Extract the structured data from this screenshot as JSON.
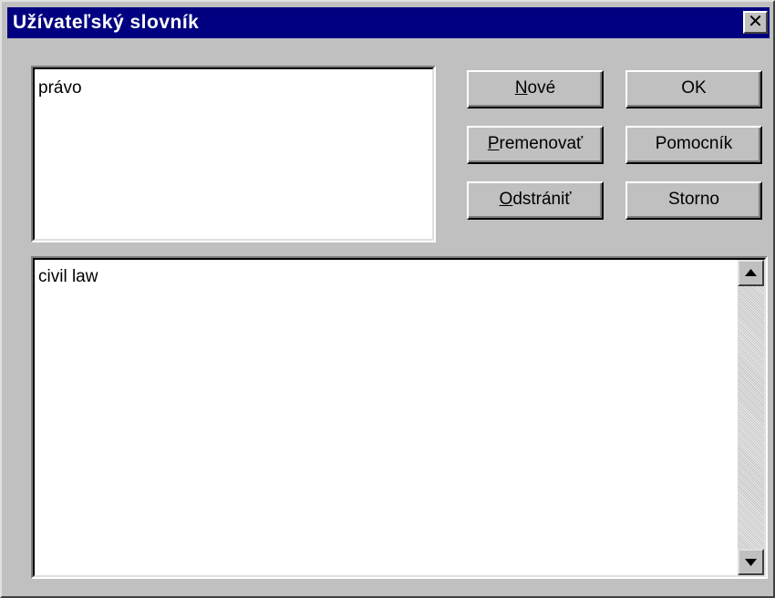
{
  "window": {
    "title": "Užívateľský slovník",
    "close_glyph": "✕"
  },
  "words_list": {
    "value": "právo"
  },
  "buttons": {
    "new": {
      "mnemonic": "N",
      "rest": "ové"
    },
    "rename": {
      "mnemonic": "P",
      "rest": "remenovať"
    },
    "delete": {
      "mnemonic": "O",
      "rest": "dstrániť"
    },
    "ok": "OK",
    "help": "Pomocník",
    "cancel": "Storno"
  },
  "definition_area": {
    "value": "civil law"
  },
  "colors": {
    "titlebar": "#000080",
    "dialog_bg": "#c0c0c0",
    "field_bg": "#ffffff"
  },
  "icons": {
    "close": "close-icon",
    "scroll_up": "scroll-up-arrow-icon",
    "scroll_down": "scroll-down-arrow-icon"
  }
}
